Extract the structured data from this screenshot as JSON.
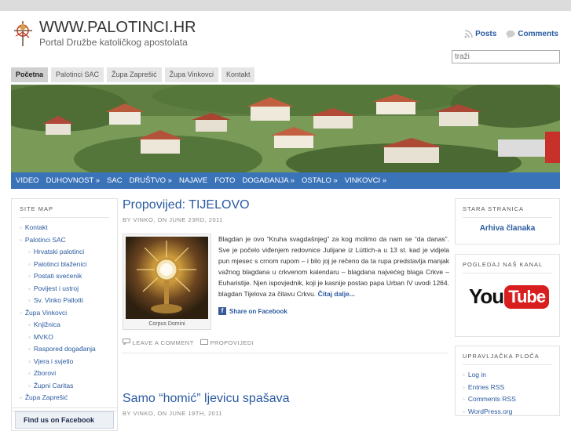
{
  "site": {
    "title": "WWW.PALOTINCI.HR",
    "description": "Portal Družbe katoličkog apostolata"
  },
  "feeds": {
    "posts": "Posts",
    "comments": "Comments"
  },
  "search": {
    "placeholder": "traži"
  },
  "pages": [
    "Početna",
    "Palotinci SAC",
    "Župa Zaprešić",
    "Župa Vinkovci",
    "Kontakt"
  ],
  "categories": [
    "VIDEO",
    "DUHOVNOST",
    "SAC",
    "DRUŠTVO",
    "NAJAVE",
    "FOTO",
    "DOGAĐANJA",
    "OSTALO",
    "VINKOVCI"
  ],
  "category_dropdown_marker": "»",
  "sitemap": {
    "title": "SITE MAP",
    "items": [
      {
        "label": "Kontakt",
        "sub": false
      },
      {
        "label": "Palotinci SAC",
        "sub": false
      },
      {
        "label": "Hrvatski palotinci",
        "sub": true
      },
      {
        "label": "Palotinci blaženici",
        "sub": true
      },
      {
        "label": "Postati svećenik",
        "sub": true
      },
      {
        "label": "Povijest i ustroj",
        "sub": true
      },
      {
        "label": "Sv. Vinko Pallotti",
        "sub": true
      },
      {
        "label": "Župa Vinkovci",
        "sub": false
      },
      {
        "label": "Knjižnica",
        "sub": true
      },
      {
        "label": "MVKO",
        "sub": true
      },
      {
        "label": "Raspored događanja",
        "sub": true
      },
      {
        "label": "Vjera i svjetlo",
        "sub": true
      },
      {
        "label": "Zborovi",
        "sub": true
      },
      {
        "label": "Župni Caritas",
        "sub": true
      },
      {
        "label": "Župa Zaprešić",
        "sub": false
      }
    ]
  },
  "facebook_box": {
    "label": "Find us on Facebook"
  },
  "posts": [
    {
      "title": "Propovijed: TIJELOVO",
      "meta": "BY VINKO, ON JUNE 23RD, 2011",
      "image_caption": "Corpus Domini",
      "text": "Blagdan je ovo “Kruha svagdašnjeg” za kog molimo da nam se “da danas”. Sve je počelo viđenjem redovnice Julijane iz Lüttich-a u 13 st. kad je vidjela pun mjesec s crnom rupom – i bilo joj je rečeno da ta rupa predstavlja manjak važnog blagdana u crkvenom kalendaru – blagdana najvećeg blaga Crkve – Euharistije. Njen ispovjednik, koji je kasnije postao papa Urban IV uvodi 1264. blagdan Tijelova za čitavu Crkvu.",
      "read_more": "Čitaj dalje...",
      "share": "Share on Facebook",
      "comments": "LEAVE A COMMENT",
      "category": "PROPOVIJEDI"
    },
    {
      "title": "Samo “homić” ljevicu spašava",
      "meta": "BY VINKO, ON JUNE 19TH, 2011"
    }
  ],
  "right_sidebar": {
    "old_site": {
      "title": "STARA STRANICA",
      "link": "Arhiva članaka"
    },
    "channel": {
      "title": "POGLEDAJ NAŠ KANAL",
      "logo_you": "You",
      "logo_tube": "Tube"
    },
    "meta": {
      "title": "UPRAVLJAČKA PLOČA",
      "items": [
        "Log in",
        "Entries RSS",
        "Comments RSS",
        "WordPress.org"
      ]
    }
  },
  "colors": {
    "accent": "#2a5aa0",
    "nav_bar": "#3b73b9",
    "topbar": "#dcdcdc"
  }
}
